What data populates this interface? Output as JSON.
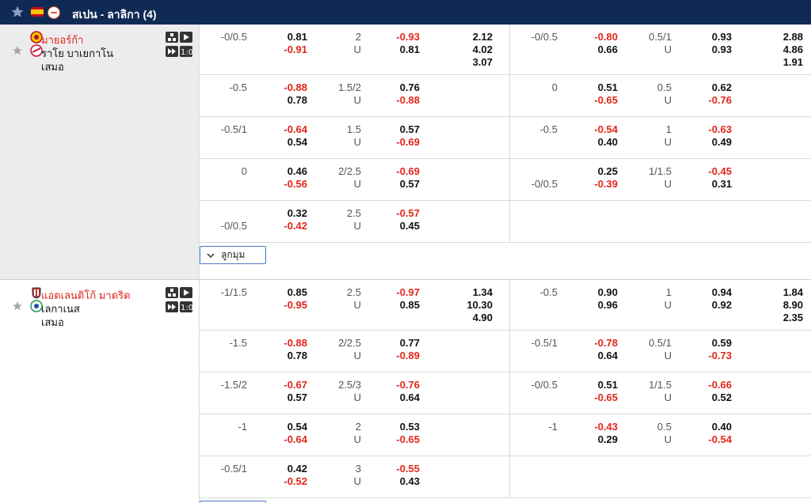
{
  "league": {
    "title": "สเปน - ลาลิกา (4)"
  },
  "matches": [
    {
      "home": "มายอร์ก้า",
      "away": "ราโย บาเยกาโน",
      "draw": "เสมอ",
      "more_label": "ลูกมุม",
      "rows": [
        {
          "h1": [
            "-0/0.5",
            "",
            "0.81",
            "-0.91",
            "2",
            "U",
            "-0.93",
            "0.81",
            "2.12",
            "4.02",
            "3.07"
          ],
          "h2": [
            "-0/0.5",
            "",
            "-0.80",
            "0.66",
            "0.5/1",
            "U",
            "0.93",
            "0.93",
            "2.88",
            "4.86",
            "1.91"
          ]
        },
        {
          "h1": [
            "-0.5",
            "",
            "-0.88",
            "0.78",
            "1.5/2",
            "U",
            "0.76",
            "-0.88"
          ],
          "h2": [
            "0",
            "",
            "0.51",
            "-0.65",
            "0.5",
            "U",
            "0.62",
            "-0.76"
          ]
        },
        {
          "h1": [
            "-0.5/1",
            "",
            "-0.64",
            "0.54",
            "1.5",
            "U",
            "0.57",
            "-0.69"
          ],
          "h2": [
            "-0.5",
            "",
            "-0.54",
            "0.40",
            "1",
            "U",
            "-0.63",
            "0.49"
          ]
        },
        {
          "h1": [
            "0",
            "",
            "0.46",
            "-0.56",
            "2/2.5",
            "U",
            "-0.69",
            "0.57"
          ],
          "h2": [
            "",
            "-0/0.5",
            "0.25",
            "-0.39",
            "1/1.5",
            "U",
            "-0.45",
            "0.31"
          ]
        },
        {
          "h1": [
            "",
            "-0/0.5",
            "0.32",
            "-0.42",
            "2.5",
            "U",
            "-0.57",
            "0.45"
          ],
          "h2": []
        }
      ]
    },
    {
      "home": "แอตเลนติโก้ มาดริด",
      "away": "เลกาเนส",
      "draw": "เสมอ",
      "rows": [
        {
          "h1": [
            "-1/1.5",
            "",
            "0.85",
            "-0.95",
            "2.5",
            "U",
            "-0.97",
            "0.85",
            "1.34",
            "10.30",
            "4.90"
          ],
          "h2": [
            "-0.5",
            "",
            "0.90",
            "0.96",
            "1",
            "U",
            "0.94",
            "0.92",
            "1.84",
            "8.90",
            "2.35"
          ]
        },
        {
          "h1": [
            "-1.5",
            "",
            "-0.88",
            "0.78",
            "2/2.5",
            "U",
            "0.77",
            "-0.89"
          ],
          "h2": [
            "-0.5/1",
            "",
            "-0.78",
            "0.64",
            "0.5/1",
            "U",
            "0.59",
            "-0.73"
          ]
        },
        {
          "h1": [
            "-1.5/2",
            "",
            "-0.67",
            "0.57",
            "2.5/3",
            "U",
            "-0.76",
            "0.64"
          ],
          "h2": [
            "-0/0.5",
            "",
            "0.51",
            "-0.65",
            "1/1.5",
            "U",
            "-0.66",
            "0.52"
          ]
        },
        {
          "h1": [
            "-1",
            "",
            "0.54",
            "-0.64",
            "2",
            "U",
            "0.53",
            "-0.65"
          ],
          "h2": [
            "-1",
            "",
            "-0.43",
            "0.29",
            "0.5",
            "U",
            "0.40",
            "-0.54"
          ]
        },
        {
          "h1": [
            "-0.5/1",
            "",
            "0.42",
            "-0.52",
            "3",
            "U",
            "-0.55",
            "0.43"
          ],
          "h2": []
        }
      ]
    }
  ]
}
